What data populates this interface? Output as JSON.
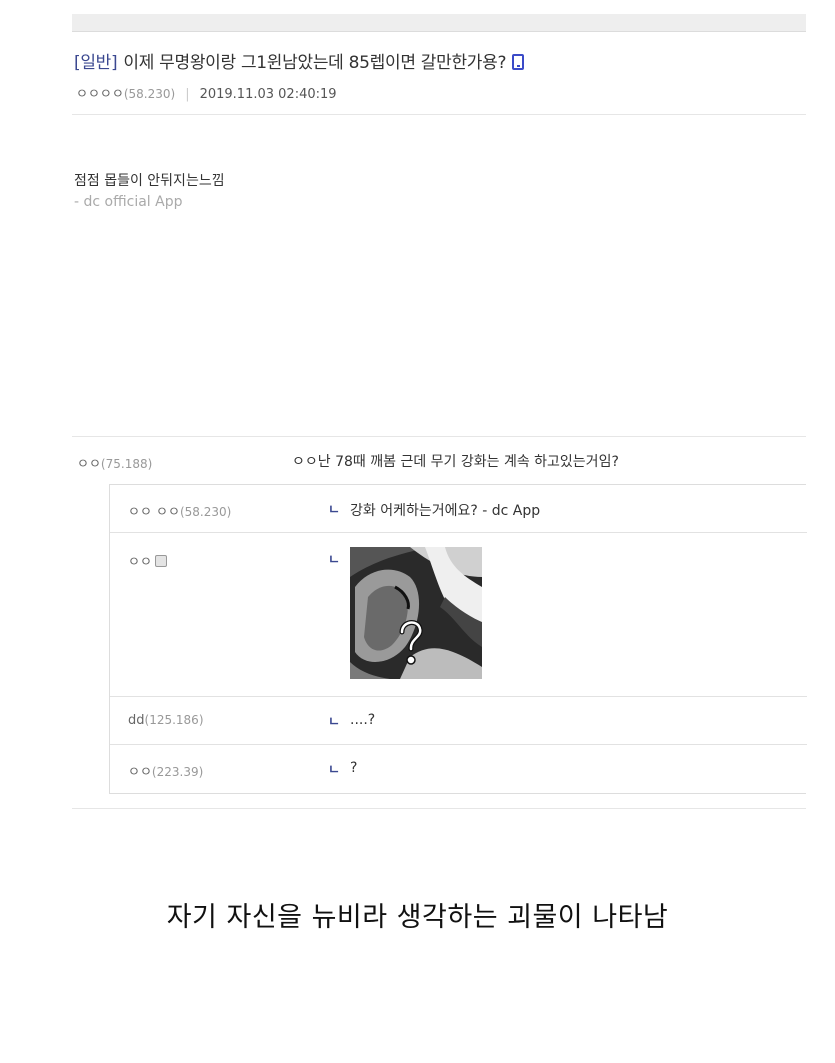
{
  "post": {
    "category": "[일반]",
    "title": "이제 무명왕이랑 그1윈남았는데 85렙이면 갈만한가용?",
    "author": "ㅇㅇㅇㅇ",
    "ip": "(58.230)",
    "date": "2019.11.03 02:40:19",
    "body": "점점 몹들이 안뒤지는느낌",
    "signature": "- dc official App"
  },
  "comment": {
    "author": "ㅇㅇ",
    "ip": "(75.188)",
    "content": "ㅇㅇ난 78때 깨봄 근데 무기 강화는 계속 하고있는거임?"
  },
  "replies": [
    {
      "author": "ㅇㅇ ㅇㅇ",
      "ip": "(58.230)",
      "arrow": "ㄴ",
      "content": "강화 어케하는거에요? - dc App"
    },
    {
      "author": "ㅇㅇ",
      "ip": "",
      "arrow": "ㄴ",
      "content": ""
    },
    {
      "author": "dd",
      "ip": "(125.186)",
      "arrow": "ㄴ",
      "content": "....?"
    },
    {
      "author": "ㅇㅇ",
      "ip": "(223.39)",
      "arrow": "ㄴ",
      "content": "?"
    }
  ],
  "caption": "자기 자신을 뉴비라 생각하는 괴물이 나타남"
}
